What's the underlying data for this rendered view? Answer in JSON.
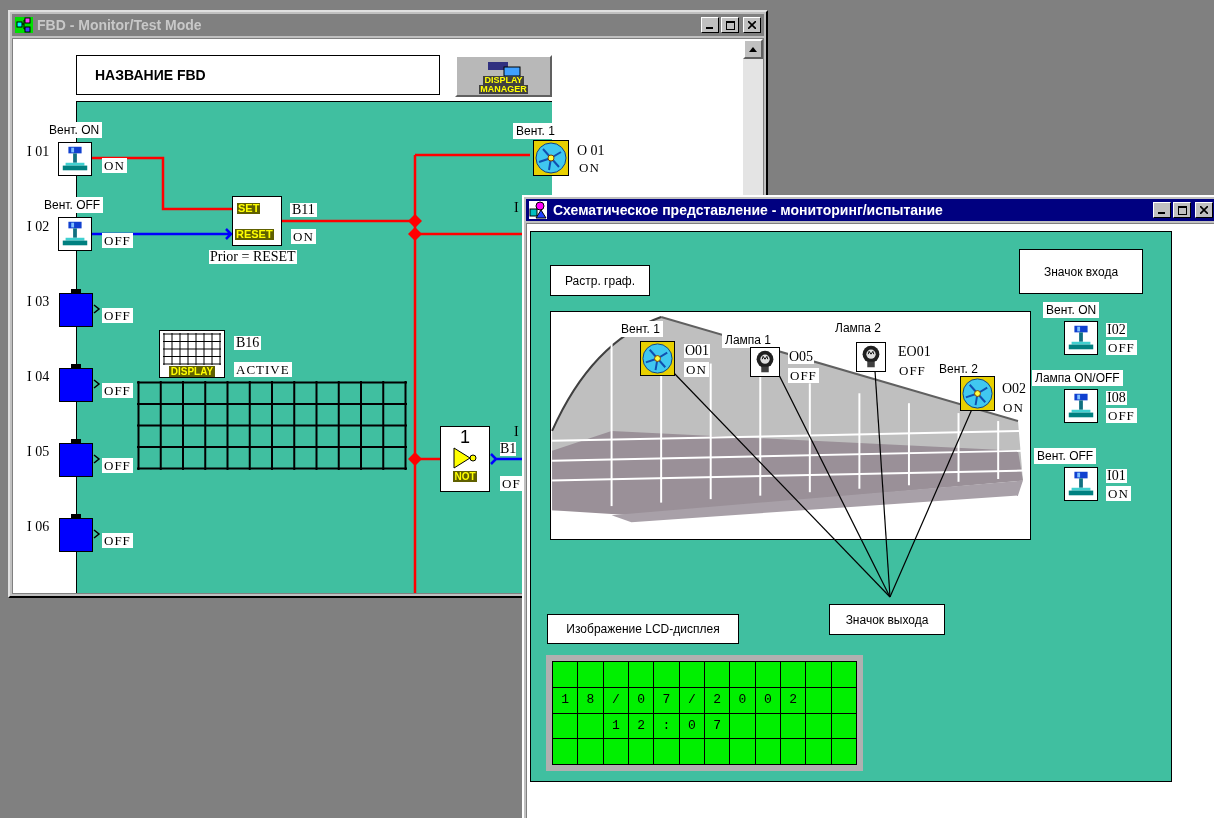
{
  "fbd_window": {
    "title": "FBD - Monitor/Test Mode",
    "name": "НАЗВАНИЕ FBD",
    "manager_caption": [
      "DISPLAY",
      "MANAGER"
    ],
    "inputs": [
      {
        "id": "I 01",
        "label": "Вент. ON",
        "kind": "switch",
        "state": "ON",
        "active": true
      },
      {
        "id": "I 02",
        "label": "Вент. OFF",
        "kind": "switch",
        "state": "OFF",
        "active": false
      },
      {
        "id": "I 03",
        "kind": "empty",
        "state": "OFF"
      },
      {
        "id": "I 04",
        "kind": "empty",
        "state": "OFF"
      },
      {
        "id": "I 05",
        "kind": "empty",
        "state": "OFF"
      },
      {
        "id": "I 06",
        "kind": "empty",
        "state": "OFF"
      }
    ],
    "latch": {
      "set": "SET",
      "reset": "RESET",
      "id": "B11",
      "state": "ON",
      "active": true,
      "note": "Prior = RESET"
    },
    "display_block": {
      "caption": "DISPLAY",
      "id": "B16",
      "state": "ACTIVE"
    },
    "not_block": {
      "number": "1",
      "caption": "NOT",
      "id": "B1",
      "state": "OF",
      "active": false
    },
    "output": {
      "label": "Вент. 1",
      "id": "O 01",
      "state": "ON"
    },
    "cut_labels": [
      "I",
      "I"
    ]
  },
  "schematic_window": {
    "title": "Схематическое представление - мониторинг/испытание",
    "raster_label": "Растр. граф.",
    "input_label": "Значок входа",
    "output_label": "Значок выхода",
    "lcd_label": "Изображение LCD-дисплея",
    "outputs": [
      {
        "label": "Вент. 1",
        "id": "O01",
        "state": "ON",
        "kind": "fan"
      },
      {
        "label": "Лампа 1",
        "id": "O05",
        "state": "OFF",
        "kind": "lamp"
      },
      {
        "label": "Лампа 2",
        "id": "EO01",
        "state": "OFF",
        "kind": "lamp"
      },
      {
        "label": "Вент. 2",
        "id": "O02",
        "state": "ON",
        "kind": "fan"
      }
    ],
    "inputs": [
      {
        "label": "Вент. ON",
        "id": "I02",
        "state": "OFF"
      },
      {
        "label": "Лампа ON/OFF",
        "id": "I08",
        "state": "OFF"
      },
      {
        "label": "Вент. OFF",
        "id": "I01",
        "state": "ON"
      }
    ],
    "lcd_rows": [
      "1 8 / 0 7 / 2 0 0 2",
      "    1 2 : 0 7"
    ]
  }
}
